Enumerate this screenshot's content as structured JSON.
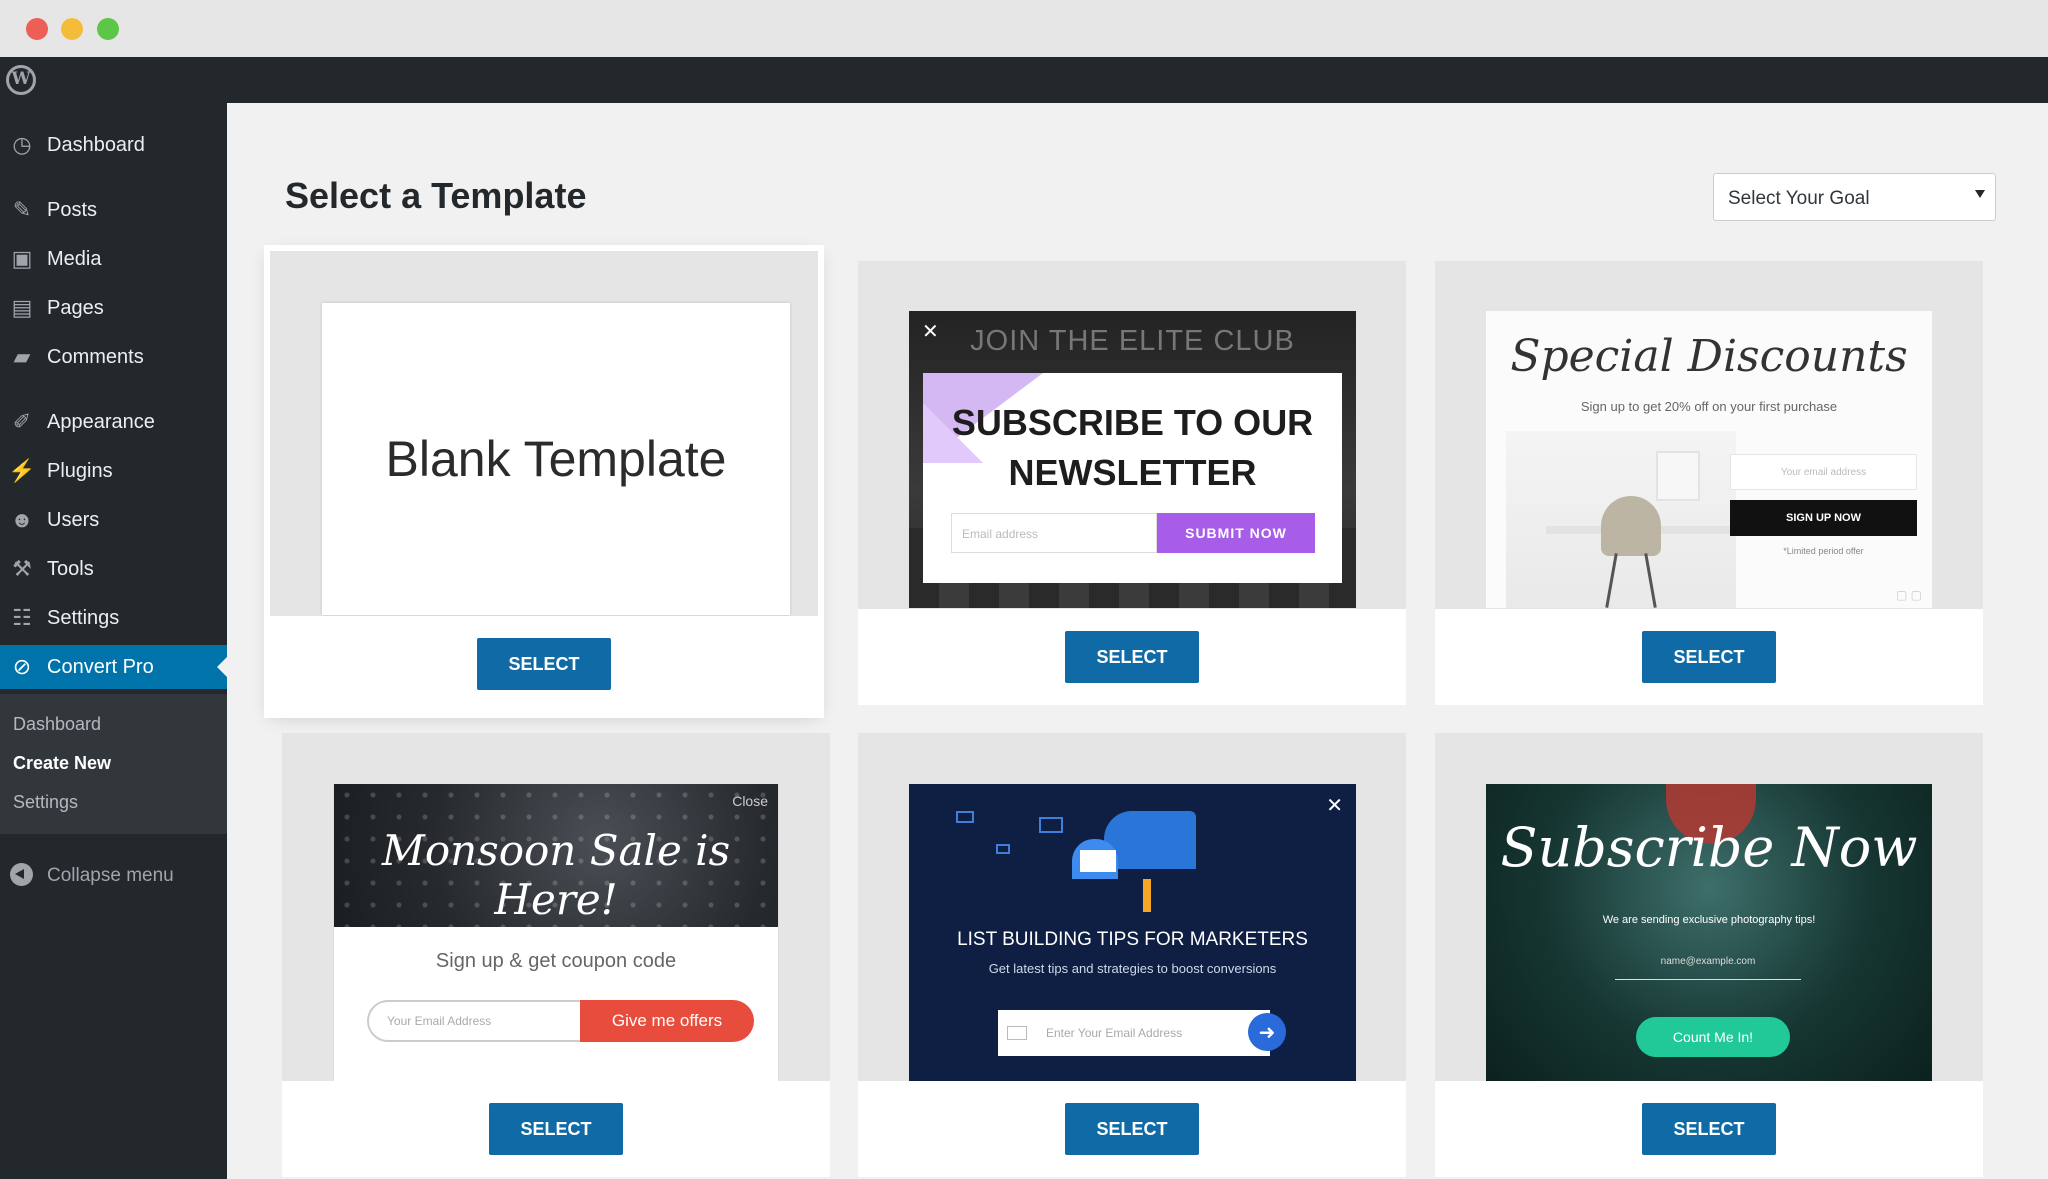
{
  "window": {
    "controls": [
      "close",
      "minimize",
      "zoom"
    ]
  },
  "sidebar": {
    "items": [
      {
        "label": "Dashboard",
        "icon": "dashboard-icon"
      },
      {
        "label": "Posts",
        "icon": "pin-icon"
      },
      {
        "label": "Media",
        "icon": "media-icon"
      },
      {
        "label": "Pages",
        "icon": "page-icon"
      },
      {
        "label": "Comments",
        "icon": "comment-icon"
      },
      {
        "label": "Appearance",
        "icon": "brush-icon"
      },
      {
        "label": "Plugins",
        "icon": "plug-icon"
      },
      {
        "label": "Users",
        "icon": "user-icon"
      },
      {
        "label": "Tools",
        "icon": "wrench-icon"
      },
      {
        "label": "Settings",
        "icon": "settings-icon"
      },
      {
        "label": "Convert Pro",
        "icon": "convert-pro-icon",
        "active": true
      }
    ],
    "submenu": [
      "Dashboard",
      "Create New",
      "Settings"
    ],
    "submenu_current": "Create New",
    "collapse_label": "Collapse menu"
  },
  "main": {
    "title": "Select a Template",
    "goal_select": {
      "value": "Select Your Goal"
    },
    "select_label": "SELECT"
  },
  "templates": {
    "blank": {
      "title": "Blank Template"
    },
    "newsletter": {
      "close": "✕",
      "banner": "JOIN THE ELITE CLUB",
      "heading": "SUBSCRIBE TO OUR NEWSLETTER",
      "email_placeholder": "Email address",
      "button": "SUBMIT NOW"
    },
    "discounts": {
      "script": "Special Discounts",
      "sub": "Sign up to get 20% off on your first purchase",
      "email_placeholder": "Your email address",
      "button": "SIGN UP NOW",
      "note": "*Limited period offer"
    },
    "monsoon": {
      "close": "Close",
      "script": "Monsoon Sale is Here!",
      "sub": "Sign up & get coupon code",
      "email_placeholder": "Your Email Address",
      "button": "Give me offers"
    },
    "listbuilding": {
      "close": "✕",
      "title": "LIST BUILDING TIPS FOR MARKETERS",
      "sub": "Get latest tips and strategies to boost conversions",
      "email_placeholder": "Enter Your Email Address"
    },
    "subscribe": {
      "script": "Subscribe Now",
      "sub": "We are sending exclusive photography tips!",
      "email_placeholder": "name@example.com",
      "button": "Count Me In!"
    }
  },
  "colors": {
    "accent": "#0073aa",
    "select_button": "#0f6aa6",
    "sidebar": "#23282d"
  }
}
